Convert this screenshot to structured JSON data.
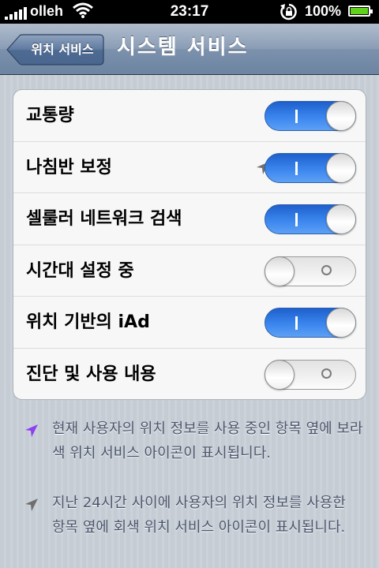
{
  "status_bar": {
    "carrier": "olleh",
    "time": "23:17",
    "battery_percent": "100%",
    "signal_bars": 5,
    "battery_level": 1.0
  },
  "nav": {
    "back_label": "위치 서비스",
    "title": "시스템 서비스"
  },
  "settings": [
    {
      "label": "교통량",
      "on": true
    },
    {
      "label": "나침반 보정",
      "on": true,
      "location_icon": "gray-location-arrow-icon"
    },
    {
      "label": "셀룰러 네트워크 검색",
      "on": true
    },
    {
      "label": "시간대 설정 중",
      "on": false
    },
    {
      "label": "위치 기반의 iAd",
      "on": true
    },
    {
      "label": "진단 및 사용 내용",
      "on": false
    }
  ],
  "notes": [
    {
      "icon": "purple-location-arrow-icon",
      "color": "#8e3ff0",
      "text": "현재 사용자의 위치 정보를 사용 중인 항목 옆에 보라색 위치 서비스 아이콘이 표시됩니다."
    },
    {
      "icon": "gray-location-arrow-icon",
      "color": "#6e6e6e",
      "text": "지난 24시간 사이에 사용자의 위치 정보를 사용한 항목 옆에 회색 위치 서비스 아이콘이 표시됩니다."
    }
  ],
  "colors": {
    "switch_on": "#3b86ee",
    "nav": "#7b91ac",
    "background": "#c5ccd4",
    "location_purple": "#8e3ff0",
    "location_gray": "#6e6e6e"
  }
}
